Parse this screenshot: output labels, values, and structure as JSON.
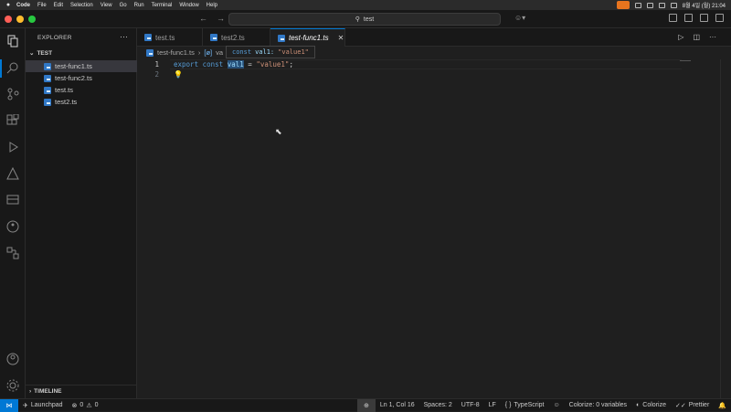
{
  "mac_menu": {
    "app": "Code",
    "items": [
      "File",
      "Edit",
      "Selection",
      "View",
      "Go",
      "Run",
      "Terminal",
      "Window",
      "Help"
    ],
    "clock": "8월 4일 (월) 21:04"
  },
  "titlebar": {
    "search_text": "test",
    "traffic_colors": [
      "#ff5f57",
      "#febc2e",
      "#28c840"
    ]
  },
  "sidebar": {
    "title": "EXPLORER",
    "folder": "TEST",
    "files": [
      {
        "name": "test-func1.ts",
        "selected": true
      },
      {
        "name": "test-func2.ts",
        "selected": false
      },
      {
        "name": "test.ts",
        "selected": false
      },
      {
        "name": "test2.ts",
        "selected": false
      }
    ],
    "timeline": "TIMELINE"
  },
  "tabs": [
    {
      "label": "test.ts",
      "active": false
    },
    {
      "label": "test2.ts",
      "active": false
    },
    {
      "label": "test-func1.ts",
      "active": true
    }
  ],
  "breadcrumb": {
    "file": "test-func1.ts",
    "symbol": "va"
  },
  "hover": {
    "keyword": "const",
    "name": "val1:",
    "value": "\"value1\""
  },
  "editor": {
    "line_numbers": [
      "1",
      "2"
    ],
    "code": {
      "export_kw": "export",
      "const_kw": "const",
      "var": "val1",
      "eq": " = ",
      "str": "\"value1\"",
      "semi": ";"
    }
  },
  "statusbar": {
    "launchpad": "Launchpad",
    "problems": "0",
    "warnings": "0",
    "position": "Ln 1, Col 16",
    "spaces": "Spaces: 2",
    "encoding": "UTF-8",
    "eol": "LF",
    "language": "TypeScript",
    "colorize_vars": "Colorize: 0 variables",
    "colorize": "Colorize",
    "prettier": "Prettier"
  },
  "colors": {
    "accent": "#0078d4",
    "bg": "#1f1f1f",
    "sidebar_bg": "#181818"
  }
}
